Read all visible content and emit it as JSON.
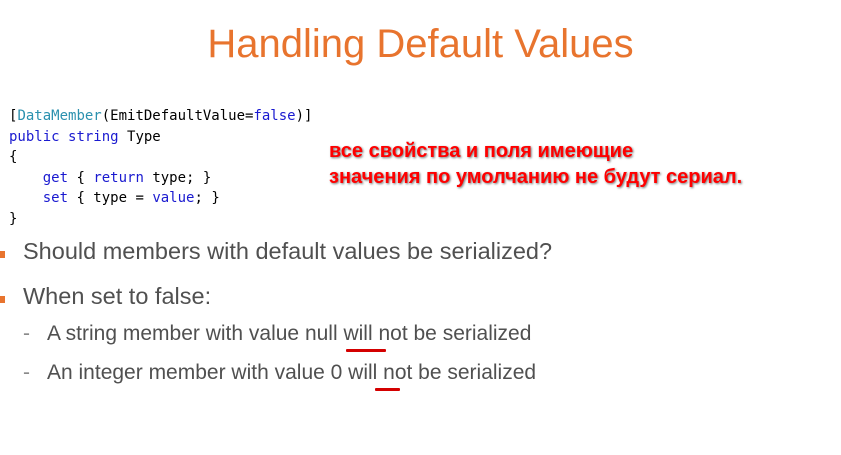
{
  "slide": {
    "title": "Handling Default Values"
  },
  "code": {
    "attr_open": "[",
    "attr_type": "DataMember",
    "attr_args_open": "(EmitDefaultValue=",
    "attr_value": "false",
    "attr_close": ")]",
    "kw_public": "public",
    "kw_string": "string",
    "prop_name": " Type",
    "brace_open": "{",
    "indent": "    ",
    "kw_get": "get",
    "get_body_open": " { ",
    "kw_return": "return",
    "get_body_rest": " type; }",
    "kw_set": "set",
    "set_body_open": " { type = ",
    "kw_value": "value",
    "set_body_rest": "; }",
    "brace_close": "}"
  },
  "annotation": {
    "line1": "все свойства и поля имеющие",
    "line2": "значения по умолчанию не будут сериал."
  },
  "bullets": [
    {
      "text": "Should members with default values be serialized?"
    },
    {
      "text": "When set to false:"
    }
  ],
  "sub_bullets": [
    {
      "dash": "-",
      "before": "A string member with value ",
      "highlight": "null",
      "after": " will not be serialized"
    },
    {
      "dash": "-",
      "before": "An integer member with value ",
      "highlight": "0",
      "after": " will not be serialized"
    }
  ],
  "colors": {
    "title": "#e8742e",
    "bullet_marker": "#e8742e",
    "annotation": "#ff0000",
    "underline": "#d40000",
    "keyword": "#1a1ad0",
    "type": "#2b91af",
    "body_text": "#505050"
  }
}
